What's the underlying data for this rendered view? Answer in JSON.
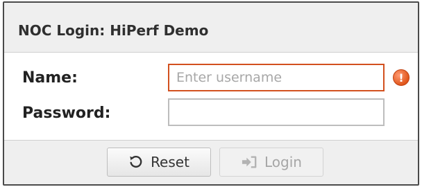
{
  "window": {
    "title": "NOC Login: HiPerf Demo"
  },
  "form": {
    "name_label": "Name:",
    "password_label": "Password:",
    "username_value": "",
    "username_placeholder": "Enter username",
    "password_value": ""
  },
  "buttons": {
    "reset_label": "Reset",
    "login_label": "Login"
  },
  "status": {
    "username_error": true
  },
  "colors": {
    "error": "#d2501e",
    "disabled_text": "#a6a6a6"
  },
  "icons": {
    "error": "exclamation-circle-icon",
    "reset": "refresh-icon",
    "login": "sign-in-icon"
  }
}
